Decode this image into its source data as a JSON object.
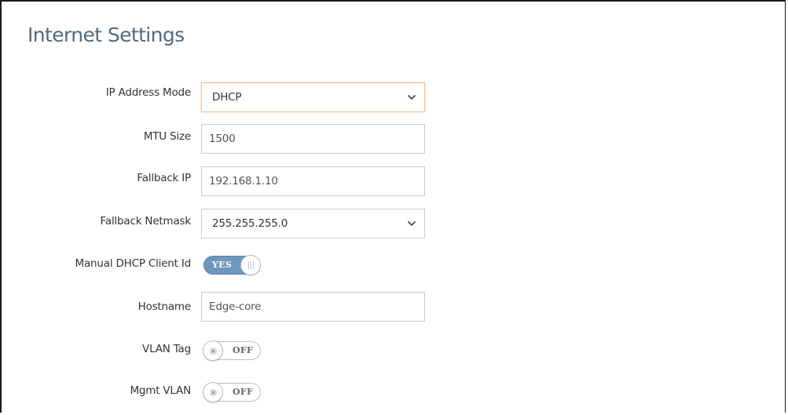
{
  "page": {
    "title": "Internet Settings"
  },
  "form": {
    "ip_address_mode": {
      "label": "IP Address Mode",
      "value": "DHCP"
    },
    "mtu_size": {
      "label": "MTU Size",
      "value": "1500"
    },
    "fallback_ip": {
      "label": "Fallback IP",
      "value": "192.168.1.10"
    },
    "fallback_netmask": {
      "label": "Fallback Netmask",
      "value": "255.255.255.0"
    },
    "manual_dhcp_client_id": {
      "label": "Manual DHCP Client Id",
      "state_text": "YES",
      "enabled": true
    },
    "hostname": {
      "label": "Hostname",
      "value": "Edge-core"
    },
    "vlan_tag": {
      "label": "VLAN Tag",
      "state_text": "OFF",
      "enabled": false
    },
    "mgmt_vlan": {
      "label": "Mgmt VLAN",
      "state_text": "OFF",
      "enabled": false
    }
  },
  "colors": {
    "title": "#546a7b",
    "toggle_on": "#6f97bd",
    "focus_border": "#f0c49a",
    "field_border": "#cccccc"
  },
  "icons": {
    "select_arrow": "chevron-down-icon",
    "toggle_on_knob": "grip-lines-icon",
    "toggle_off_knob": "close-icon"
  }
}
